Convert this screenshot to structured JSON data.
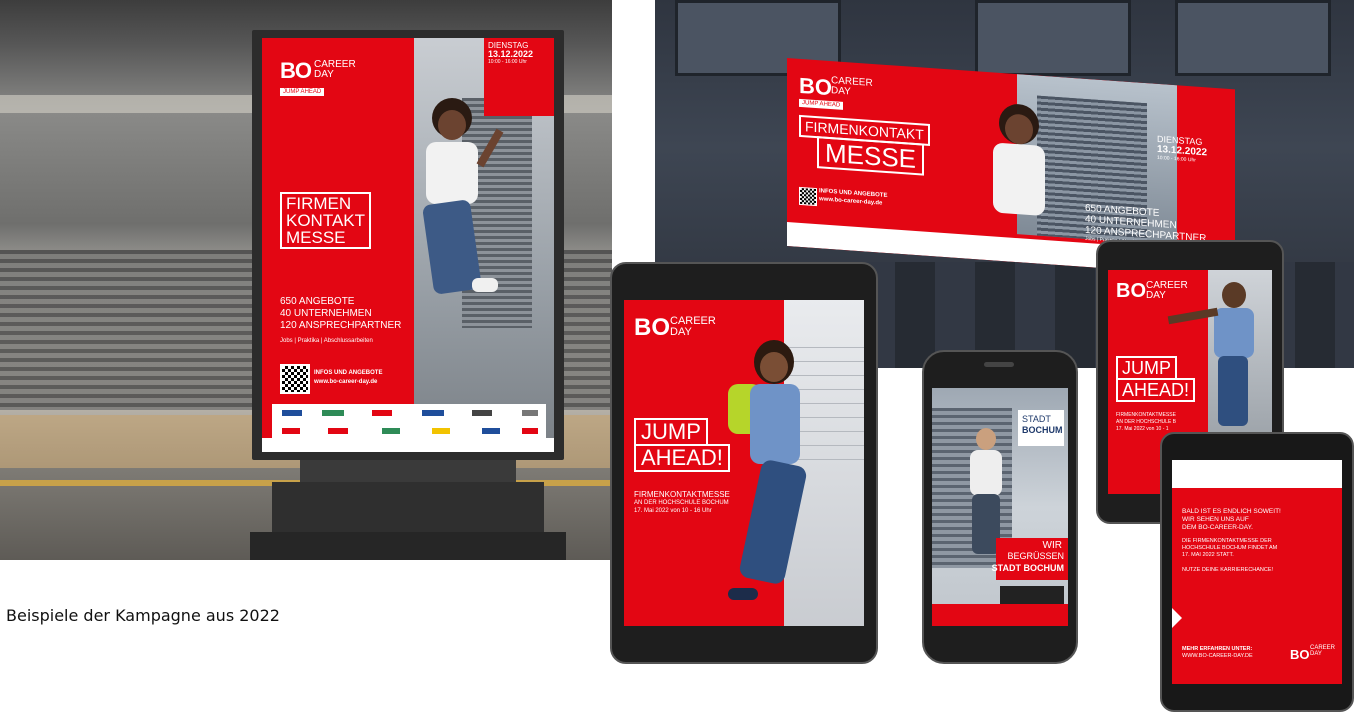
{
  "caption": "Beispiele der Kampagne aus 2022",
  "brand": {
    "bo": "BO",
    "career": "CAREER",
    "day": "DAY",
    "jump_ahead_small": "JUMP AHEAD",
    "red": "#e30613"
  },
  "billboard": {
    "date_day": "DIENSTAG",
    "date": "13.12.2022",
    "time": "10:00 - 16:00 Uhr",
    "headline": [
      "FIRMEN",
      "KONTAKT",
      "MESSE"
    ],
    "stats": [
      "650 ANGEBOTE",
      "40 UNTERNEHMEN",
      "120 ANSPRECHPARTNER"
    ],
    "sub": "Jobs | Praktika | Abschlussarbeiten",
    "info_title": "INFOS UND ANGEBOTE",
    "info_url": "www.bo-career-day.de"
  },
  "banner": {
    "headline1": "FIRMENKONTAKT",
    "headline2": "MESSE",
    "date_day": "DIENSTAG",
    "date": "13.12.2022",
    "time": "10:00 - 16:00 Uhr",
    "stats": [
      "650 ANGEBOTE",
      "40 UNTERNEHMEN",
      "120 ANSPRECHPARTNER"
    ],
    "sub": "Jobs | Praktika | Abschlussarbeiten",
    "info_title": "INFOS UND ANGEBOTE",
    "info_url": "www.bo-career-day.de"
  },
  "tablet_left": {
    "headline": [
      "JUMP",
      "AHEAD!"
    ],
    "sub1": "FIRMENKONTAKTMESSE",
    "sub2": "AN DER HOCHSCHULE BOCHUM",
    "sub3": "17. Mai 2022 von 10 - 16 Uhr"
  },
  "phone": {
    "stadt": "STADT",
    "bochum": "BOCHUM",
    "wir": "WIR",
    "begruessen": "BEGRÜSSEN",
    "stadt_bochum": "STADT BOCHUM"
  },
  "tablet_right": {
    "headline": [
      "JUMP",
      "AHEAD!"
    ],
    "sub1": "FIRMENKONTAKTMESSE",
    "sub2": "AN DER HOCHSCHULE B",
    "sub3": "17. Mai 2022 von 10 - 1"
  },
  "tablet_front": {
    "line1": "BALD IST ES ENDLICH SOWEIT!",
    "line2": "WIR SEHEN UNS AUF",
    "line3": "DEM BO-CAREER-DAY.",
    "line4": "DIE FIRMENKONTAKTMESSE DER",
    "line5": "HOCHSCHULE BOCHUM FINDET AM",
    "line6": "17. MAI 2022 STATT.",
    "line7": "NUTZE DEINE KARRIERECHANCE!",
    "more": "MEHR ERFAHREN UNTER:",
    "url": "WWW.BO-CAREER-DAY.DE"
  }
}
